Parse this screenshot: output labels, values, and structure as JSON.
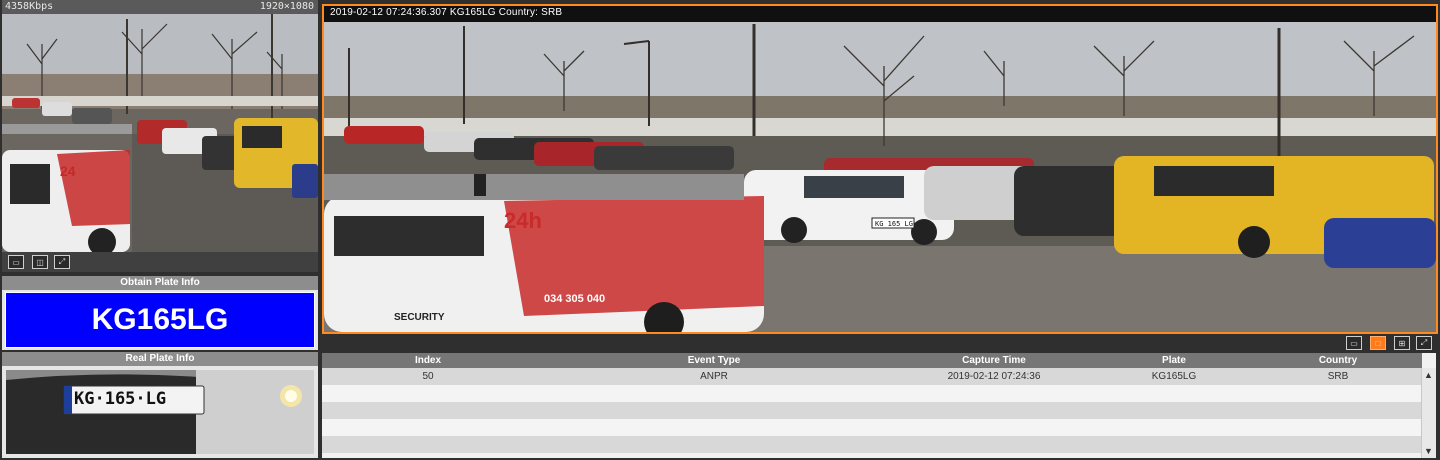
{
  "live_view": {
    "bitrate": "4358Kbps",
    "resolution": "1920×1080",
    "toolbar_icons": [
      "snapshot-icon",
      "split-window-icon",
      "fullscreen-icon"
    ]
  },
  "obtain_plate": {
    "title": "Obtain Plate Info",
    "plate": "KG165LG",
    "plate_bg_color": "#0000ff"
  },
  "real_plate": {
    "title": "Real Plate Info",
    "plate_text": "KG·165·LG"
  },
  "main_view": {
    "osd": "2019-02-12 07:24:36.307 KG165LG Country: SRB",
    "border_color": "#ff8a1f",
    "toolbar_icons": [
      "snapshot-icon",
      "single-view-icon",
      "quad-view-icon",
      "fullscreen-icon"
    ],
    "car_plate": "KG 165 LG",
    "van_text_24": "24h",
    "van_phone": "034 305 040",
    "van_brand": "SECURITY"
  },
  "event_table": {
    "columns": [
      "Index",
      "Event Type",
      "Capture Time",
      "Plate",
      "Country"
    ],
    "rows": [
      [
        "50",
        "ANPR",
        "2019-02-12 07:24:36",
        "KG165LG",
        "SRB"
      ],
      [
        "",
        "",
        "",
        "",
        ""
      ],
      [
        "",
        "",
        "",
        "",
        ""
      ],
      [
        "",
        "",
        "",
        "",
        ""
      ],
      [
        "",
        "",
        "",
        "",
        ""
      ]
    ]
  }
}
